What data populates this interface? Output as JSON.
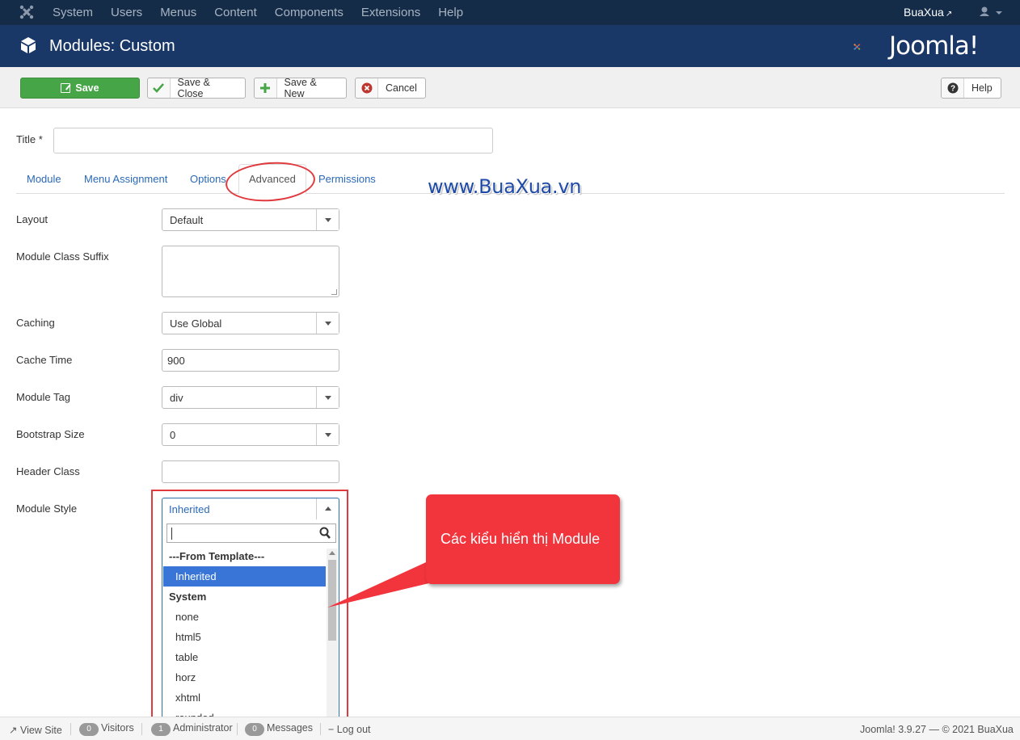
{
  "topnav": {
    "menu": [
      "System",
      "Users",
      "Menus",
      "Content",
      "Components",
      "Extensions",
      "Help"
    ],
    "site_name": "BuaXua"
  },
  "header": {
    "title": "Modules: Custom",
    "brand": "Joomla!"
  },
  "toolbar": {
    "save": "Save",
    "save_close": "Save & Close",
    "save_new": "Save & New",
    "cancel": "Cancel",
    "help": "Help"
  },
  "form": {
    "title_label": "Title *",
    "title_value": "",
    "tabs": [
      "Module",
      "Menu Assignment",
      "Options",
      "Advanced",
      "Permissions"
    ],
    "active_tab": "Advanced",
    "fields": {
      "layout": {
        "label": "Layout",
        "value": "Default"
      },
      "module_class_suffix": {
        "label": "Module Class Suffix",
        "value": ""
      },
      "caching": {
        "label": "Caching",
        "value": "Use Global"
      },
      "cache_time": {
        "label": "Cache Time",
        "value": "900"
      },
      "module_tag": {
        "label": "Module Tag",
        "value": "div"
      },
      "bootstrap_size": {
        "label": "Bootstrap Size",
        "value": "0"
      },
      "header_class": {
        "label": "Header Class",
        "value": ""
      },
      "module_style": {
        "label": "Module Style",
        "value": "Inherited"
      }
    }
  },
  "dropdown": {
    "options": [
      {
        "label": "---From Template---",
        "kind": "group"
      },
      {
        "label": "Inherited",
        "kind": "option",
        "highlighted": true
      },
      {
        "label": "System",
        "kind": "group"
      },
      {
        "label": "none",
        "kind": "option"
      },
      {
        "label": "html5",
        "kind": "option"
      },
      {
        "label": "table",
        "kind": "option"
      },
      {
        "label": "horz",
        "kind": "option"
      },
      {
        "label": "xhtml",
        "kind": "option"
      },
      {
        "label": "rounded",
        "kind": "option"
      }
    ]
  },
  "annotation": {
    "watermark": "www.BuaXua.vn",
    "callout": "Các kiểu hiển thị Module",
    "color": "#f2343d"
  },
  "status": {
    "view_site": "View Site",
    "visitors_count": "0",
    "visitors": "Visitors",
    "admin_count": "1",
    "administrator": "Administrator",
    "messages_count": "0",
    "messages": "Messages",
    "logout": "Log out",
    "version": "Joomla! 3.9.27 — © 2021 BuaXua"
  },
  "colors": {
    "topnav": "#152c48",
    "header": "#1a3867",
    "save": "#46a546",
    "highlight": "#3875d7",
    "link": "#2a69b8"
  }
}
